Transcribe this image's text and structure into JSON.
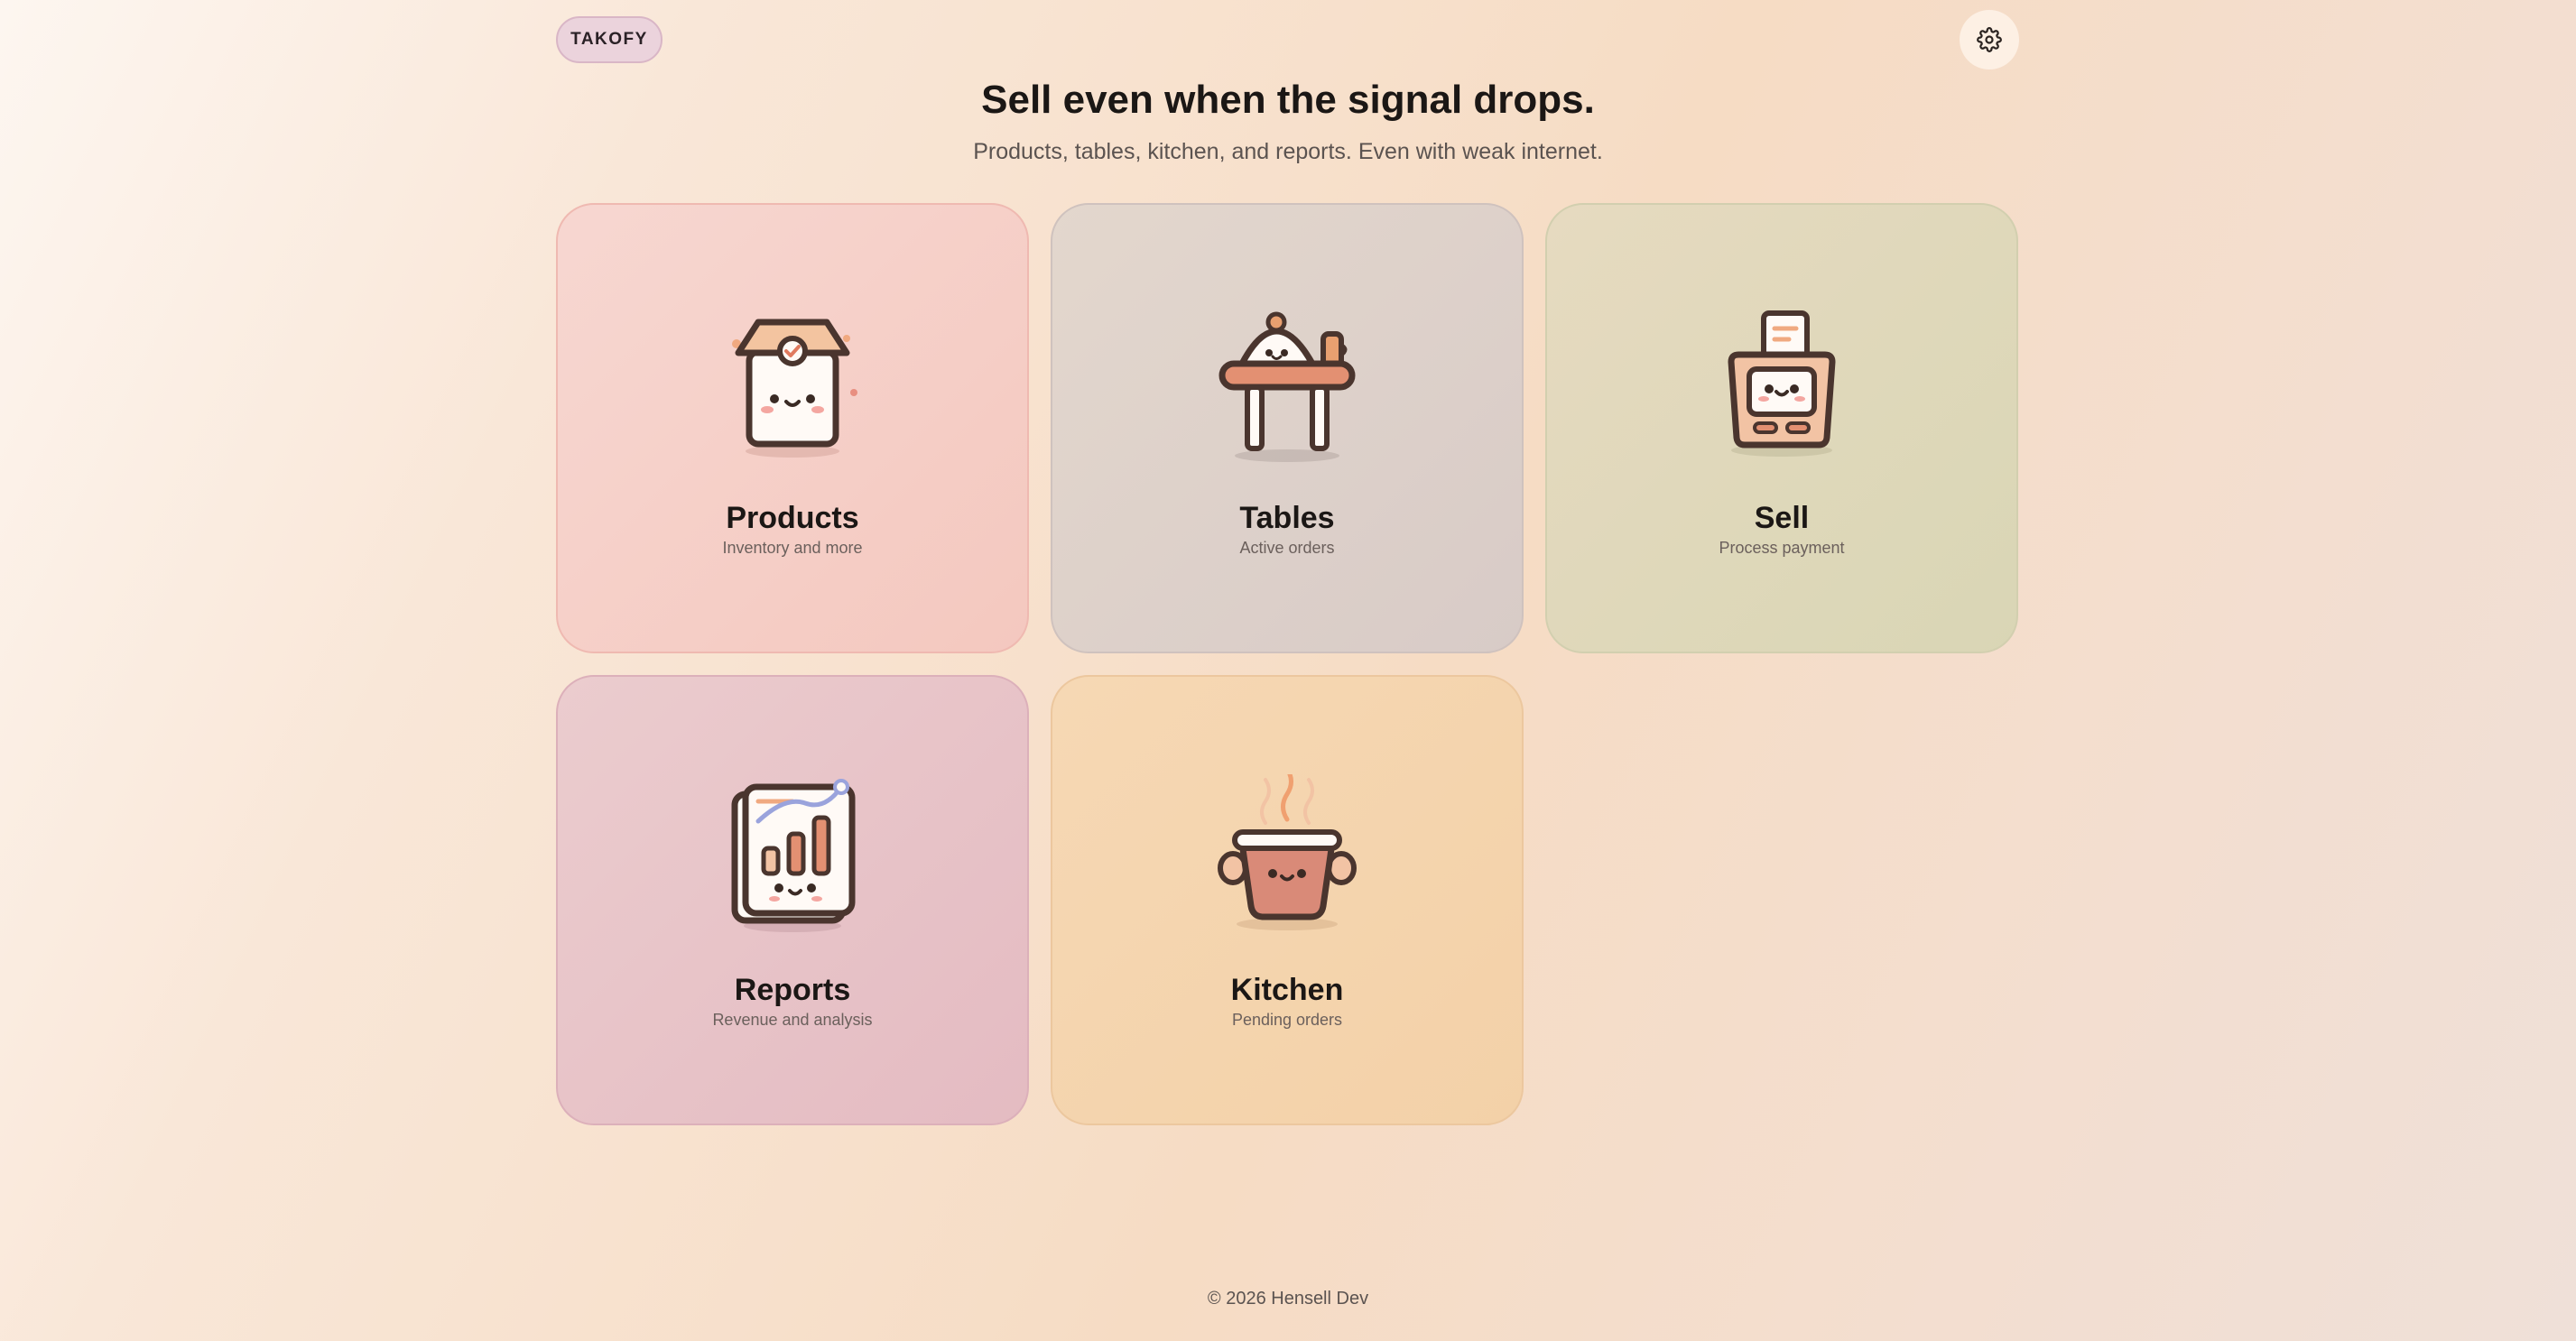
{
  "brand": {
    "label": "TAKOFY"
  },
  "header": {
    "title": "Sell even when the signal drops.",
    "subtitle": "Products, tables, kitchen, and reports. Even with weak internet."
  },
  "settings": {
    "icon": "gear-icon"
  },
  "cards": [
    {
      "title": "Products",
      "description": "Inventory and more",
      "icon": "box-icon"
    },
    {
      "title": "Tables",
      "description": "Active orders",
      "icon": "table-icon"
    },
    {
      "title": "Sell",
      "description": "Process payment",
      "icon": "pos-terminal-icon"
    },
    {
      "title": "Reports",
      "description": "Revenue and analysis",
      "icon": "chart-icon"
    },
    {
      "title": "Kitchen",
      "description": "Pending orders",
      "icon": "pot-icon"
    }
  ],
  "footer": {
    "text": "© 2026 Hensell Dev"
  },
  "colors": {
    "products": "#f6d0c8",
    "tables": "#ddd1ca",
    "sell": "#e0d8bb",
    "reports": "#e8c4c8",
    "kitchen": "#f5d5ae",
    "outline": "#4a352e"
  }
}
